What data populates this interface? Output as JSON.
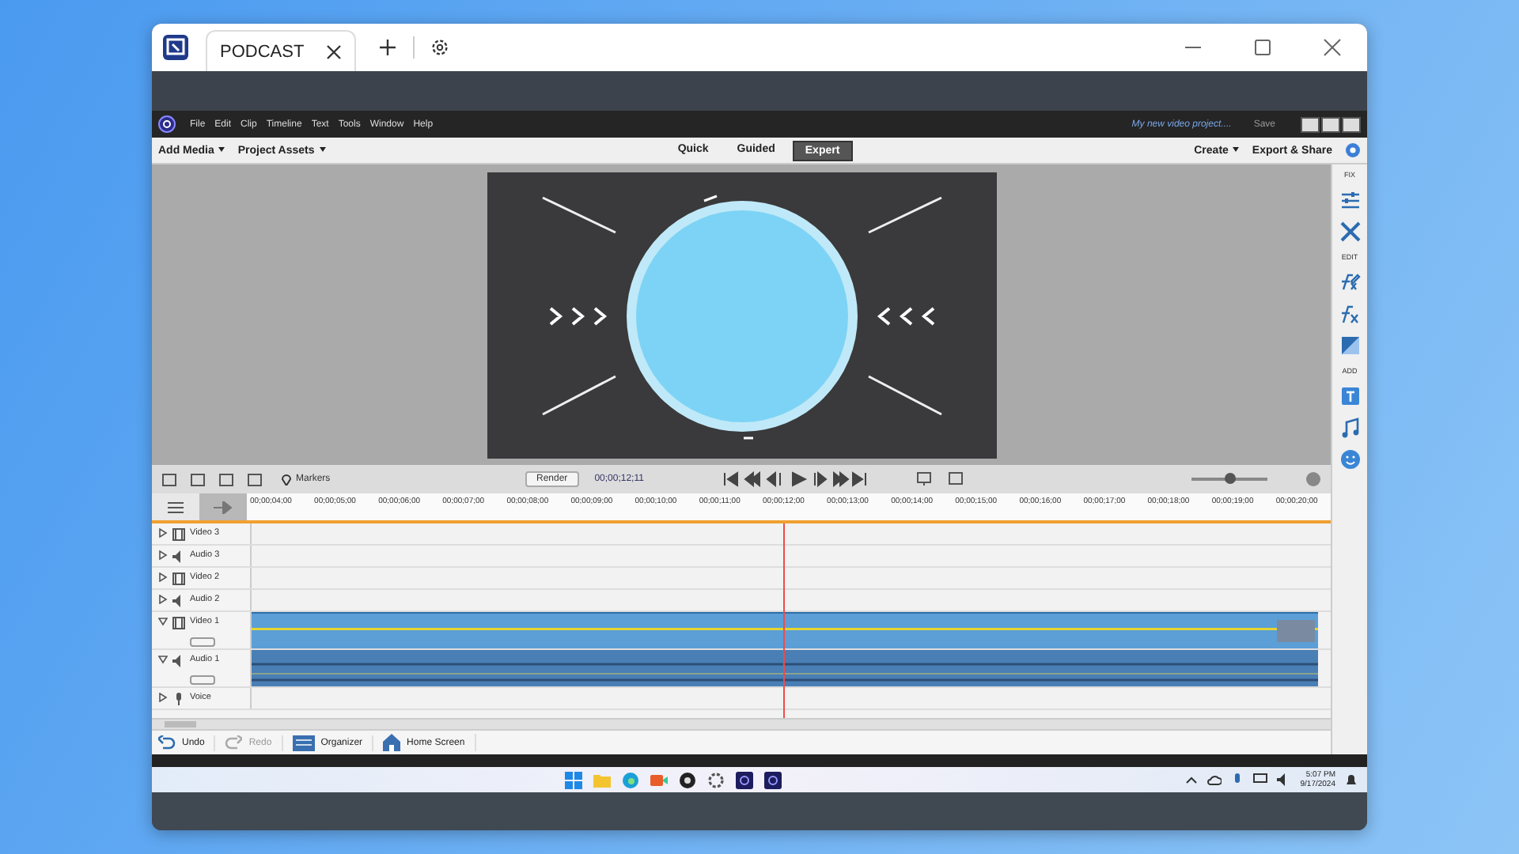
{
  "browser_tab": {
    "title": "PODCAST"
  },
  "menu_bar": {
    "items": [
      "File",
      "Edit",
      "Clip",
      "Timeline",
      "Text",
      "Tools",
      "Window",
      "Help"
    ],
    "project_name": "My new video project....",
    "save": "Save"
  },
  "toolbar": {
    "left": [
      "Add Media",
      "Project Assets"
    ],
    "modes": [
      {
        "label": "Quick",
        "selected": false
      },
      {
        "label": "Guided",
        "selected": false
      },
      {
        "label": "Expert",
        "selected": true
      }
    ],
    "right": [
      {
        "label": "Create",
        "kind": "dropdown"
      },
      {
        "label": "Export & Share",
        "kind": "button"
      }
    ]
  },
  "right_panel": [
    {
      "kind": "heading",
      "label": "FIX"
    },
    {
      "kind": "icon"
    },
    {
      "kind": "icon"
    },
    {
      "kind": "heading",
      "label": "EDIT"
    },
    {
      "kind": "icon"
    },
    {
      "kind": "icon"
    },
    {
      "kind": "icon"
    },
    {
      "kind": "heading",
      "label": "ADD"
    },
    {
      "kind": "icon"
    },
    {
      "kind": "icon"
    },
    {
      "kind": "icon"
    }
  ],
  "timeline": {
    "markers": "Markers",
    "render": "Render",
    "timecode": "00;00;12;11",
    "zoom": {
      "level": 0.5
    },
    "playhead": {
      "level": 0.5
    },
    "ruler": [
      "00;00;04;00",
      "00;00;05;00",
      "00;00;06;00",
      "00;00;07;00",
      "00;00;08;00",
      "00;00;09;00",
      "00;00;10;00",
      "00;00;11;00",
      "00;00;12;00",
      "00;00;13;00",
      "00;00;14;00",
      "00;00;15;00",
      "00;00;16;00",
      "00;00;17;00",
      "00;00;18;00",
      "00;00;19;00",
      "00;00;20;00"
    ],
    "tracks": [
      {
        "name": "Video 3",
        "kind": "video",
        "expanded": false
      },
      {
        "name": "Audio 3",
        "kind": "audio",
        "expanded": false
      },
      {
        "name": "Video 2",
        "kind": "video",
        "expanded": false
      },
      {
        "name": "Audio 2",
        "kind": "audio",
        "expanded": false
      },
      {
        "name": "Video 1",
        "kind": "video",
        "expanded": true
      },
      {
        "name": "Audio 1",
        "kind": "audio",
        "expanded": true
      },
      {
        "name": "Voice",
        "kind": "voice",
        "expanded": false
      }
    ]
  },
  "bottom_bar": [
    {
      "label": "Undo",
      "disabled": false
    },
    {
      "label": "Redo",
      "disabled": true
    },
    {
      "label": "Organizer",
      "disabled": false
    },
    {
      "label": "Home Screen",
      "disabled": false
    }
  ],
  "taskbar": {
    "time": "5:07 PM",
    "date": "9/17/2024"
  }
}
